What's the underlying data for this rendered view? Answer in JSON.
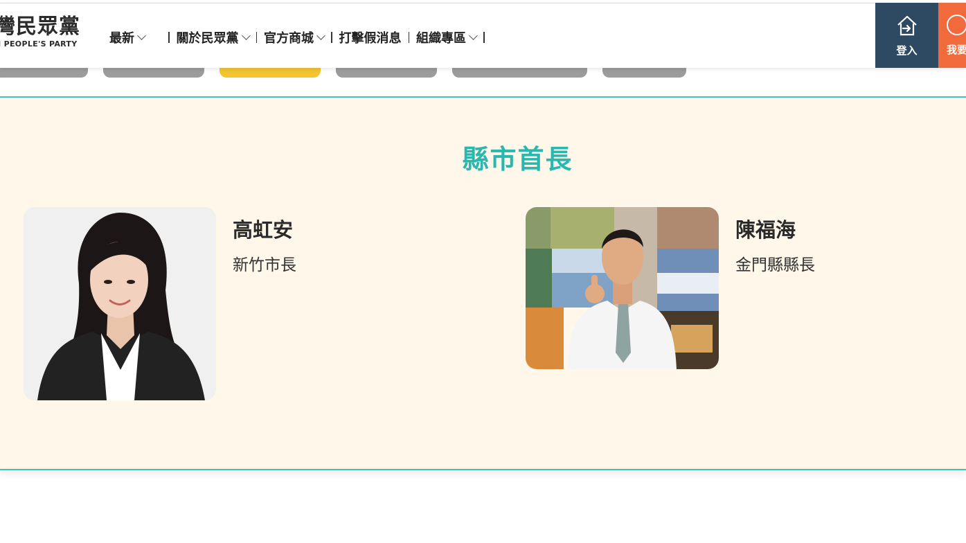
{
  "header": {
    "logo_cn": "灣民眾黨",
    "logo_en": "N PEOPLE'S PARTY",
    "nav": [
      {
        "label": "最新",
        "has_dropdown": true
      },
      {
        "label": "關於民眾黨",
        "has_dropdown": true
      },
      {
        "label": "官方商城",
        "has_dropdown": true
      },
      {
        "label": "打擊假消息",
        "has_dropdown": false
      },
      {
        "label": "組織專區",
        "has_dropdown": true
      }
    ],
    "login_label": "登入",
    "join_label": "我要",
    "login_color": "#2e4a63",
    "join_color": "#f06a3c"
  },
  "pills": {
    "active_color": "#f2c531",
    "inactive_color": "#9c9c9c"
  },
  "section": {
    "title": "縣市首長",
    "title_color": "#2ab7b0",
    "background": "#fff8ea",
    "people": [
      {
        "name": "高虹安",
        "title": "新竹市長"
      },
      {
        "name": "陳福海",
        "title": "金門縣縣長"
      }
    ]
  }
}
